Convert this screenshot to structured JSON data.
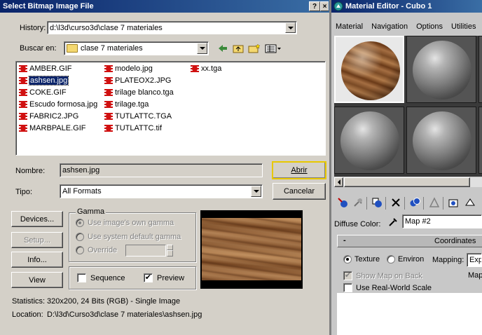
{
  "dialog": {
    "title": "Select Bitmap Image File",
    "help_glyph": "?",
    "close_glyph": "×",
    "history_label": "History:",
    "history_value": "d:\\l3d\\curso3d\\clase 7 materiales",
    "lookin_label": "Buscar en:",
    "lookin_value": "clase 7 materiales",
    "files_col1": [
      "AMBER.GIF",
      "ashsen.jpg",
      "COKE.GIF",
      "Escudo formosa.jpg",
      "FABRIC2.JPG",
      "MARBPALE.GIF"
    ],
    "files_col2": [
      "modelo.jpg",
      "PLATEOX2.JPG",
      "trilage blanco.tga",
      "trilage.tga",
      "TUTLATTC.TGA",
      "TUTLATTC.tif"
    ],
    "files_col3": [
      "xx.tga"
    ],
    "selected_file": "ashsen.jpg",
    "name_label": "Nombre:",
    "name_value": "ashsen.jpg",
    "type_label": "Tipo:",
    "type_value": "All Formats",
    "open_button": "Abrir",
    "cancel_button": "Cancelar",
    "devices_button": "Devices...",
    "setup_button": "Setup...",
    "info_button": "Info...",
    "view_button": "View",
    "gamma_title": "Gamma",
    "gamma_own": "Use image's own gamma",
    "gamma_system": "Use system default gamma",
    "gamma_override": "Override",
    "sequence_label": "Sequence",
    "preview_label": "Preview",
    "preview_checked": true,
    "sequence_checked": false,
    "statistics_label": "Statistics:",
    "statistics_value": "320x200, 24 Bits (RGB) - Single Image",
    "location_label": "Location:",
    "location_value": "D:\\l3d\\Curso3d\\clase 7 materiales\\ashsen.jpg"
  },
  "material_editor": {
    "title": "Material Editor - Cubo 1",
    "menu": [
      "Material",
      "Navigation",
      "Options",
      "Utilities"
    ],
    "diffuse_label": "Diffuse Color:",
    "map_value": "Map #2",
    "coordinates_title": "Coordinates",
    "rollout_minus": "-",
    "texture_label": "Texture",
    "environ_label": "Environ",
    "mapping_label": "Mapping:",
    "mapping_value": "Exp",
    "map_cut": "Map",
    "show_map_label": "Show Map on Back",
    "real_world_label": "Use Real-World Scale",
    "show_map_checked": true
  },
  "colors": {
    "title_active": "#0a246a",
    "dialog_bg": "#d4d0c8",
    "focus_highlight": "#e8c800"
  }
}
